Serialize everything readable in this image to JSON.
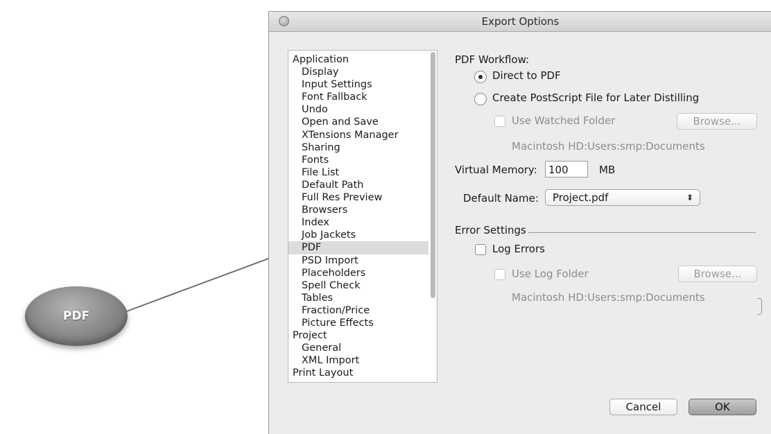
{
  "callout": {
    "label": "PDF"
  },
  "window": {
    "title": "Export Options"
  },
  "list": {
    "items": [
      {
        "label": "Application",
        "level": 0
      },
      {
        "label": "Display",
        "level": 1
      },
      {
        "label": "Input Settings",
        "level": 1
      },
      {
        "label": "Font Fallback",
        "level": 1
      },
      {
        "label": "Undo",
        "level": 1
      },
      {
        "label": "Open and Save",
        "level": 1
      },
      {
        "label": "XTensions Manager",
        "level": 1
      },
      {
        "label": "Sharing",
        "level": 1
      },
      {
        "label": "Fonts",
        "level": 1
      },
      {
        "label": "File List",
        "level": 1
      },
      {
        "label": "Default Path",
        "level": 1
      },
      {
        "label": "Full Res Preview",
        "level": 1
      },
      {
        "label": "Browsers",
        "level": 1
      },
      {
        "label": "Index",
        "level": 1
      },
      {
        "label": "Job Jackets",
        "level": 1
      },
      {
        "label": "PDF",
        "level": 1,
        "selected": true
      },
      {
        "label": "PSD Import",
        "level": 1
      },
      {
        "label": "Placeholders",
        "level": 1
      },
      {
        "label": "Spell Check",
        "level": 1
      },
      {
        "label": "Tables",
        "level": 1
      },
      {
        "label": "Fraction/Price",
        "level": 1
      },
      {
        "label": "Picture Effects",
        "level": 1
      },
      {
        "label": "Project",
        "level": 0
      },
      {
        "label": "General",
        "level": 1
      },
      {
        "label": "XML Import",
        "level": 1
      },
      {
        "label": "Print Layout",
        "level": 0
      }
    ]
  },
  "pdf_workflow": {
    "heading": "PDF Workflow:",
    "direct_label": "Direct to PDF",
    "postscript_label": "Create PostScript File for Later Distilling",
    "selected": "Direct to PDF",
    "watched_folder_label": "Use Watched Folder",
    "browse_label": "Browse...",
    "watched_path": "Macintosh HD:Users:smp:Documents"
  },
  "virtual_memory": {
    "label": "Virtual Memory:",
    "value": "100",
    "unit": "MB"
  },
  "default_name": {
    "label": "Default Name:",
    "value": "Project.pdf",
    "arrows": "⬍"
  },
  "error_settings": {
    "heading": "Error Settings",
    "log_errors_label": "Log Errors",
    "log_folder_label": "Use Log Folder",
    "browse_label": "Browse...",
    "log_path": "Macintosh HD:Users:smp:Documents"
  },
  "buttons": {
    "cancel": "Cancel",
    "ok": "OK"
  }
}
